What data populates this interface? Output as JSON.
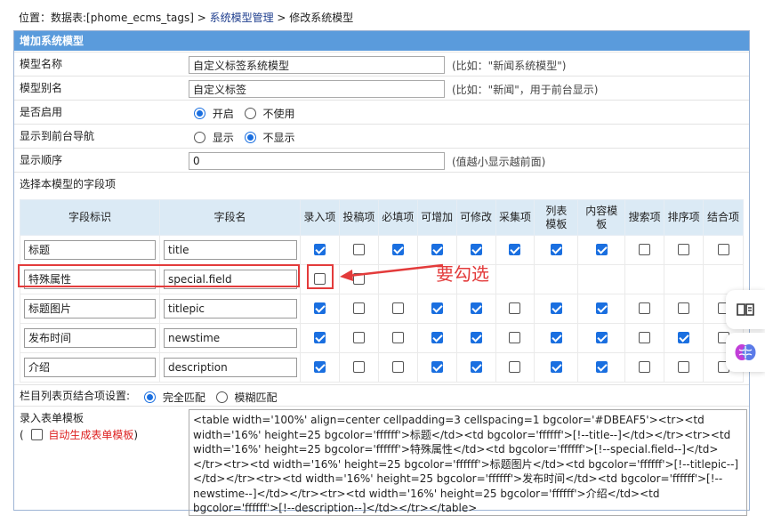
{
  "breadcrumb": {
    "prefix": "位置：数据表:[phome_ecms_tags] > ",
    "link": "系统模型管理",
    "suffix": " > 修改系统模型"
  },
  "panel_title": "增加系统模型",
  "form": {
    "model_name": {
      "label": "模型名称",
      "value": "自定义标签系统模型",
      "hint": "(比如：\"新闻系统模型\")"
    },
    "model_alias": {
      "label": "模型别名",
      "value": "自定义标签",
      "hint": "(比如：\"新闻\"，用于前台显示)"
    },
    "enabled": {
      "label": "是否启用",
      "opt_on": "开启",
      "opt_off": "不使用",
      "selected": "开启"
    },
    "show_nav": {
      "label": "显示到前台导航",
      "opt_show": "显示",
      "opt_hide": "不显示",
      "selected": "不显示"
    },
    "order": {
      "label": "显示顺序",
      "value": "0",
      "hint": "(值越小显示越前面)"
    },
    "fields_label": "选择本模型的字段项"
  },
  "grid": {
    "headers": [
      "字段标识",
      "字段名",
      "录入项",
      "投稿项",
      "必填项",
      "可增加",
      "可修改",
      "采集项",
      "列表模板",
      "内容模板",
      "搜索项",
      "排序项",
      "结合项"
    ],
    "rows": [
      {
        "label": "标题",
        "name": "title",
        "checks": [
          true,
          false,
          true,
          true,
          true,
          true,
          true,
          true,
          false,
          false,
          false
        ]
      },
      {
        "label": "特殊属性",
        "name": "special.field",
        "checks": [
          false,
          false,
          null,
          null,
          null,
          null,
          null,
          null,
          null,
          null,
          null
        ]
      },
      {
        "label": "标题图片",
        "name": "titlepic",
        "checks": [
          true,
          false,
          false,
          true,
          true,
          false,
          true,
          true,
          false,
          false,
          false
        ]
      },
      {
        "label": "发布时间",
        "name": "newstime",
        "checks": [
          true,
          false,
          false,
          true,
          true,
          false,
          true,
          true,
          false,
          true,
          false
        ]
      },
      {
        "label": "介绍",
        "name": "description",
        "checks": [
          true,
          false,
          false,
          true,
          true,
          false,
          true,
          true,
          false,
          false,
          false
        ]
      }
    ]
  },
  "annotation": "要勾选",
  "list_combine": {
    "label": "栏目列表页结合项设置:",
    "opt_exact": "完全匹配",
    "opt_fuzzy": "模糊匹配",
    "selected": "完全匹配"
  },
  "form_template": {
    "label": "录入表单模板",
    "paren_open": "(",
    "paren_close": ")",
    "auto_label": "自动生成表单模板",
    "content": "<table width='100%' align=center cellpadding=3 cellspacing=1 bgcolor='#DBEAF5'><tr><td width='16%' height=25 bgcolor='ffffff'>标题</td><td bgcolor='ffffff'>[!--title--]</td></tr><tr><td width='16%' height=25 bgcolor='ffffff'>特殊属性</td><td bgcolor='ffffff'>[!--special.field--]</td></tr><tr><td width='16%' height=25 bgcolor='ffffff'>标题图片</td><td bgcolor='ffffff'>[!--titlepic--]</td></tr><tr><td width='16%' height=25 bgcolor='ffffff'>发布时间</td><td bgcolor='ffffff'>[!--newstime--]</td></tr><tr><td width='16%' height=25 bgcolor='ffffff'>介绍</td><td bgcolor='ffffff'>[!--description--]</td></tr></table>"
  },
  "side_icons": [
    "book-icon",
    "brain-icon"
  ],
  "colors": {
    "header": "#5a9bdc",
    "grid_head": "#dbeaf5",
    "accent": "#1a6fe0",
    "annot": "#e33b3b"
  }
}
